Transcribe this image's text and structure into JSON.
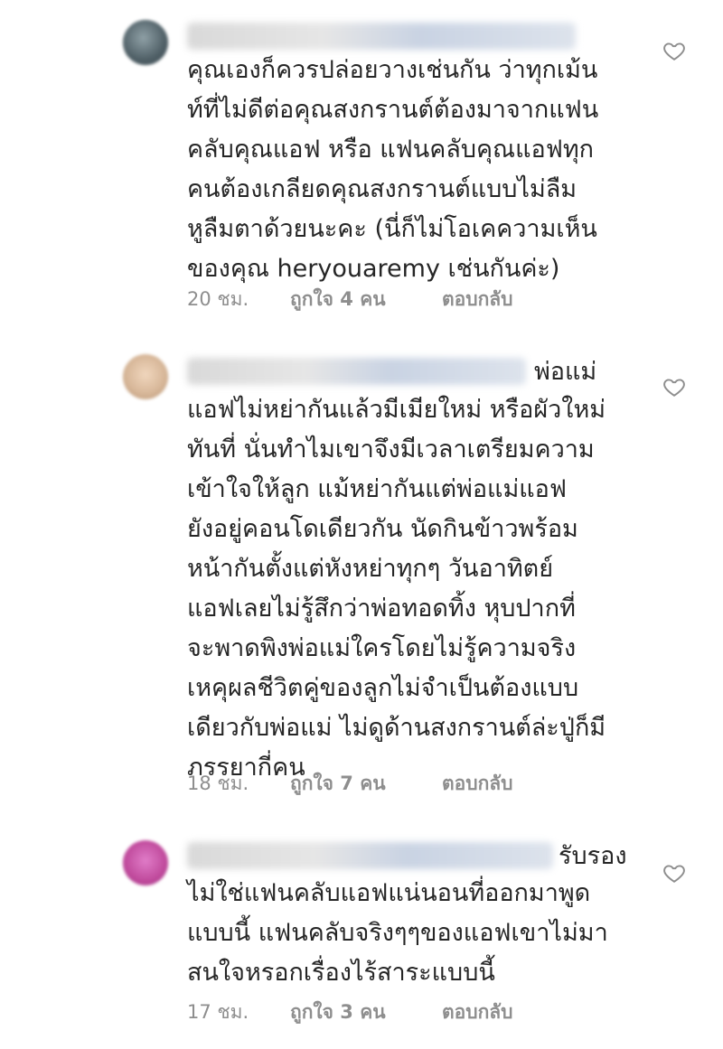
{
  "comments": [
    {
      "username_blurred": true,
      "avatar_color": "#4f5f66",
      "inline_prefix": "",
      "lines": [
        "คุณเองก็ควรปล่อยวางเช่นกัน ว่าทุกเม้น",
        "ท์ที่ไม่ดีต่อคุณสงกรานต์ต้องมาจากแฟน",
        "คลับคุณแอฟ หรือ แฟนคลับคุณแอฟทุก",
        "คนต้องเกลียดคุณสงกรานต์แบบไม่ลืม",
        "หูลืมตาด้วยนะคะ (นี่ก็ไม่โอเคความเห็น",
        "ของคุณ heryouaremy เช่นกันค่ะ)"
      ],
      "time": "20 ชม.",
      "likes": "ถูกใจ 4 คน",
      "reply": "ตอบกลับ"
    },
    {
      "username_blurred": true,
      "avatar_color": "#d8b89a",
      "inline_prefix": "พ่อแม่",
      "lines": [
        "แอฟไม่หย่ากันแล้วมีเมียใหม่ หรือผัวใหม่",
        "ทันที่ นั่นทำไมเขาจึงมีเวลาเตรียมความ",
        "เข้าใจให้ลูก แม้หย่ากันแต่พ่อแม่แอฟ",
        "ยังอยู่คอนโดเดียวกัน นัดกินข้าวพร้อม",
        "หน้ากันตั้งแต่หังหย่าทุกๆ วันอาทิตย์",
        "แอฟเลยไม่รู้สึกว่าพ่อทอดทิ้ง หุบปากที่",
        "จะพาดพิงพ่อแม่ใครโดยไม่รู้ความจริง",
        "เหคุผลชีวิตคู่ของลูกไม่จำเป็นต้องแบบ",
        "เดียวกับพ่อแม่ ไม่ดูด้านสงกรานต์ล่ะปู่ก็มี",
        "ภรรยากี่คน"
      ],
      "time": "18 ชม.",
      "likes": "ถูกใจ 7 คน",
      "reply": "ตอบกลับ"
    },
    {
      "username_blurred": true,
      "avatar_color": "#c04a9c",
      "inline_prefix": "รับรอง",
      "lines": [
        "ไม่ใช่แฟนคลับแอฟแน่นอนที่ออกมาพูด",
        "แบบนี้ แฟนคลับจริงๆๆของแอฟเขาไม่มา",
        "สนใจหรอกเรื่องไร้สาระแบบนี้"
      ],
      "time": "17 ชม.",
      "likes": "ถูกใจ 3 คน",
      "reply": "ตอบกลับ"
    }
  ],
  "icons": {
    "like": "heart-outline-icon"
  },
  "colors": {
    "text": "#262626",
    "meta": "#8e8e8e",
    "heart": "#8e8e8e"
  }
}
